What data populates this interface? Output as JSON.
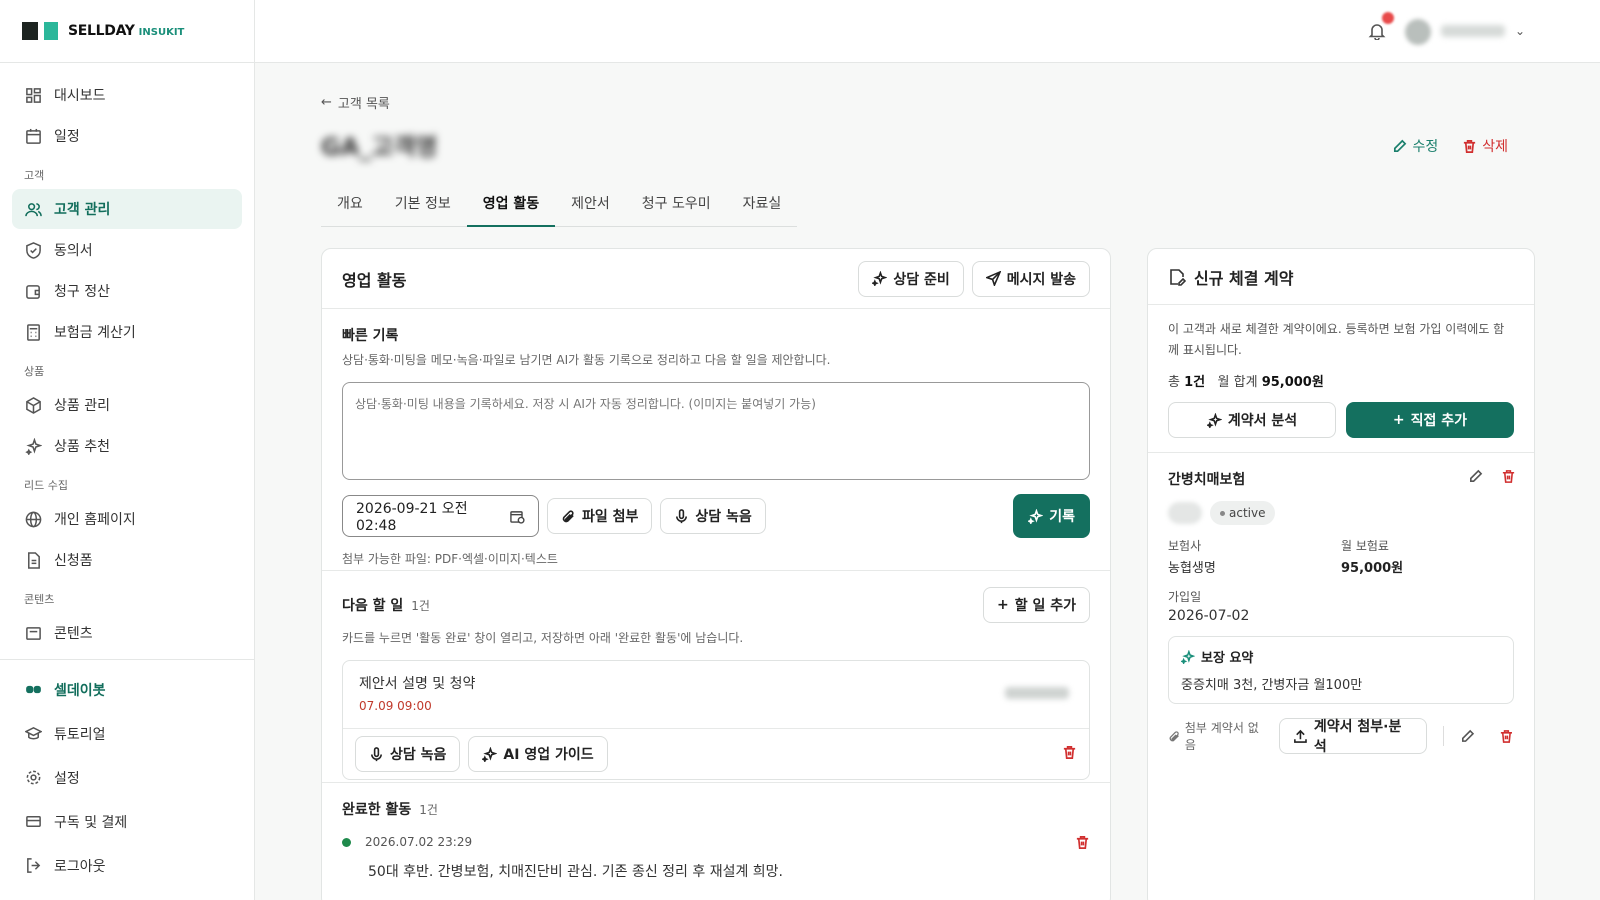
{
  "brand": {
    "name": "SELLDAY",
    "sub": "INSUKIT"
  },
  "sidebar": {
    "items_top": [
      {
        "label": "대시보드",
        "icon": "grid-icon"
      },
      {
        "label": "일정",
        "icon": "calendar-icon"
      }
    ],
    "section_customer": "고객",
    "items_customer": [
      {
        "label": "고객 관리",
        "icon": "users-icon"
      },
      {
        "label": "동의서",
        "icon": "shield-icon"
      },
      {
        "label": "청구 정산",
        "icon": "wallet-icon"
      },
      {
        "label": "보험금 계산기",
        "icon": "calculator-icon"
      }
    ],
    "section_product": "상품",
    "items_product": [
      {
        "label": "상품 관리",
        "icon": "box-icon"
      },
      {
        "label": "상품 추천",
        "icon": "sparkle-icon"
      }
    ],
    "section_lead": "리드 수집",
    "items_lead": [
      {
        "label": "개인 홈페이지",
        "icon": "globe-icon"
      },
      {
        "label": "신청폼",
        "icon": "form-icon"
      }
    ],
    "section_content": "콘텐츠",
    "items_content": [
      {
        "label": "콘텐츠",
        "icon": "content-icon"
      }
    ],
    "bottom": [
      {
        "label": "셀데이봇",
        "icon": "bot-icon"
      },
      {
        "label": "튜토리얼",
        "icon": "graduation-icon"
      },
      {
        "label": "설정",
        "icon": "gear-icon"
      },
      {
        "label": "구독 및 결제",
        "icon": "card-icon"
      },
      {
        "label": "로그아웃",
        "icon": "logout-icon"
      }
    ]
  },
  "header": {
    "back_label": "고객 목록",
    "customer_name": "GA_고객명",
    "edit_label": "수정",
    "delete_label": "삭제"
  },
  "tabs": [
    {
      "label": "개요"
    },
    {
      "label": "기본 정보"
    },
    {
      "label": "영업 활동"
    },
    {
      "label": "제안서"
    },
    {
      "label": "청구 도우미"
    },
    {
      "label": "자료실"
    }
  ],
  "sales": {
    "title": "영업 활동",
    "prep_label": "상담 준비",
    "message_label": "메시지 발송",
    "quick": {
      "title": "빠른 기록",
      "desc": "상담·통화·미팅을 메모·녹음·파일로 남기면 AI가 활동 기록으로 정리하고 다음 할 일을 제안합니다.",
      "placeholder": "상담·통화·미팅 내용을 기록하세요. 저장 시 AI가 자동 정리합니다. (이미지는 붙여넣기 가능)",
      "datetime": "2026-09-21 오전 02:48",
      "attach_label": "파일 첨부",
      "record_label": "상담 녹음",
      "save_label": "기록",
      "attach_note": "첨부 가능한 파일: PDF·엑셀·이미지·텍스트"
    },
    "todo": {
      "title": "다음 할 일",
      "count": "1건",
      "add_label": "할 일 추가",
      "desc": "카드를 누르면 '활동 완료' 창이 열리고, 저장하면 아래 '완료한 활동'에 남습니다.",
      "item_title": "제안서 설명 및 청약",
      "item_time": "07.09 09:00",
      "record_label": "상담 녹음",
      "ai_guide_label": "AI 영업 가이드"
    },
    "done": {
      "title": "완료한 활동",
      "count": "1건",
      "date": "2026.07.02 23:29",
      "text": "50대 후반. 간병보험, 치매진단비 관심. 기존 종신 정리 후 재설계 희망."
    }
  },
  "contract": {
    "title": "신규 체결 계약",
    "desc": "이 고객과 새로 체결한 계약이에요. 등록하면 보험 가입 이력에도 함께 표시됩니다.",
    "total_prefix": "총",
    "total_count": "1건",
    "monthly_prefix": "월 합계",
    "monthly_total": "95,000원",
    "analyze_label": "계약서 분석",
    "add_label": "직접 추가",
    "item": {
      "name": "간병치매보험",
      "status": "active",
      "insurer_label": "보험사",
      "insurer": "농협생명",
      "premium_label": "월 보험료",
      "premium": "95,000원",
      "join_label": "가입일",
      "join_date": "2026-07-02",
      "summary_title": "보장 요약",
      "summary": "중증치매 3천, 간병자금 월100만",
      "no_attach": "첨부 계약서 없음",
      "attach_analyze_label": "계약서 첨부·분석"
    }
  },
  "colors": {
    "accent": "#14705f",
    "danger": "#d12f2f"
  }
}
